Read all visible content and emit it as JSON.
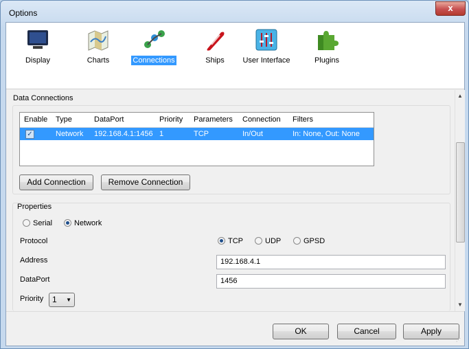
{
  "window": {
    "title": "Options",
    "close_glyph": "x"
  },
  "toolbar": {
    "items": [
      {
        "label": "Display",
        "icon": "monitor-icon",
        "selected": false
      },
      {
        "label": "Charts",
        "icon": "chart-map-icon",
        "selected": false
      },
      {
        "label": "Connections",
        "icon": "network-connections-icon",
        "selected": true
      },
      {
        "label": "Ships",
        "icon": "ship-icon",
        "selected": false
      },
      {
        "label": "User Interface",
        "icon": "sliders-icon",
        "selected": false
      },
      {
        "label": "Plugins",
        "icon": "puzzle-icon",
        "selected": false
      }
    ]
  },
  "data_connections": {
    "title": "Data Connections",
    "columns": [
      "Enable",
      "Type",
      "DataPort",
      "Priority",
      "Parameters",
      "Connection",
      "Filters"
    ],
    "rows": [
      {
        "enable": true,
        "type": "Network",
        "dataport": "192.168.4.1:1456",
        "priority": "1",
        "parameters": "TCP",
        "connection": "In/Out",
        "filters": "In: None, Out: None"
      }
    ],
    "add_label": "Add Connection",
    "remove_label": "Remove Connection"
  },
  "properties": {
    "title": "Properties",
    "source_options": [
      {
        "label": "Serial",
        "checked": false
      },
      {
        "label": "Network",
        "checked": true
      }
    ],
    "protocol_label": "Protocol",
    "protocol_options": [
      {
        "label": "TCP",
        "checked": true
      },
      {
        "label": "UDP",
        "checked": false
      },
      {
        "label": "GPSD",
        "checked": false
      }
    ],
    "address_label": "Address",
    "address_value": "192.168.4.1",
    "dataport_label": "DataPort",
    "dataport_value": "1456",
    "priority_label": "Priority",
    "priority_value": "1"
  },
  "footer": {
    "ok_label": "OK",
    "cancel_label": "Cancel",
    "apply_label": "Apply"
  },
  "colors": {
    "selection": "#3399ff",
    "titlebar": "#c6d9ee"
  }
}
